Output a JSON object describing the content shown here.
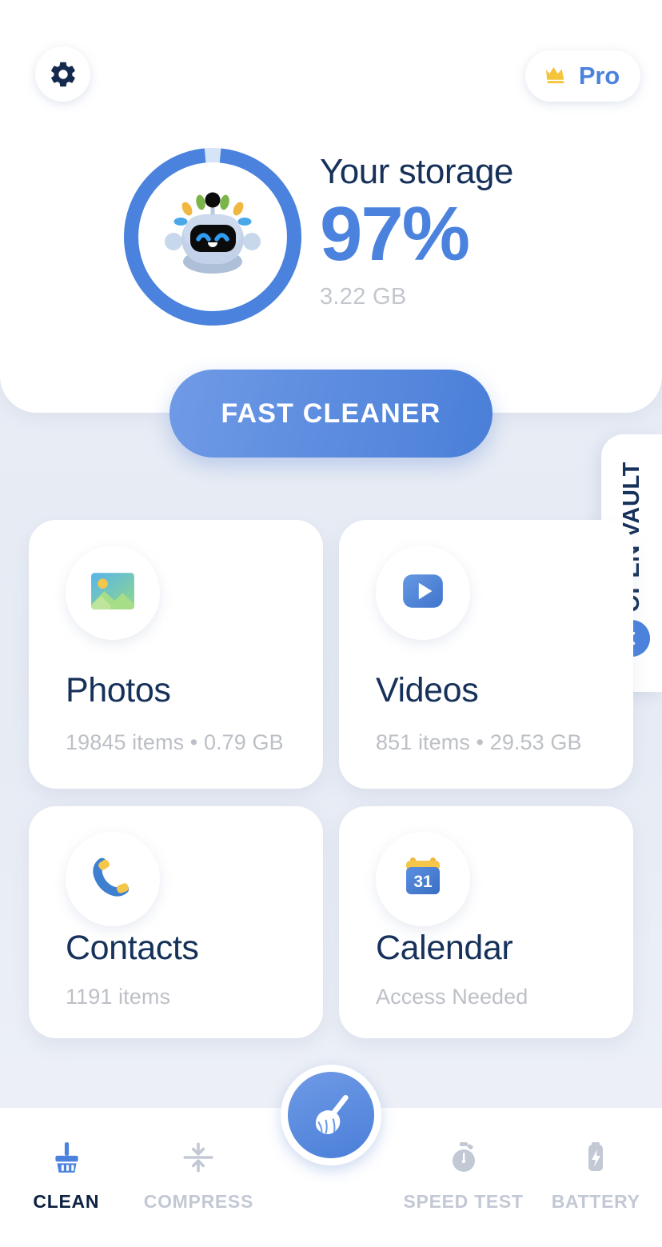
{
  "header": {
    "settings_icon": "gear-icon",
    "pro": {
      "label": "Pro",
      "icon": "crown-icon",
      "color": "#4a82dd",
      "crown_color": "#f5c43d"
    }
  },
  "storage": {
    "title": "Your storage",
    "percent_label": "97%",
    "percent_value": 97,
    "size_label": "3.22  GB",
    "ring_color": "#4a82dd",
    "ring_track_color": "#d6e4f7",
    "percent_color": "#4a82dd",
    "mascot_icon": "robot-mascot-icon"
  },
  "primary_action": {
    "label": "FAST CLEANER"
  },
  "vault": {
    "label": "OPEN VAULT",
    "chevron_icon": "chevron-left-icon"
  },
  "categories": [
    {
      "id": "photos",
      "icon": "photo-icon",
      "title": "Photos",
      "subtitle": "19845 items • 0.79 GB"
    },
    {
      "id": "videos",
      "icon": "video-play-icon",
      "title": "Videos",
      "subtitle": "851 items • 29.53 GB"
    },
    {
      "id": "contacts",
      "icon": "phone-icon",
      "title": "Contacts",
      "subtitle": "1191 items"
    },
    {
      "id": "calendar",
      "icon": "calendar-icon",
      "title": "Calendar",
      "subtitle": "Access Needed",
      "calendar_day": "31"
    }
  ],
  "bottom_nav": {
    "items": [
      {
        "id": "clean",
        "label": "CLEAN",
        "icon": "broom-icon",
        "active": true
      },
      {
        "id": "compress",
        "label": "COMPRESS",
        "icon": "compress-arrows-icon",
        "active": false
      },
      {
        "id": "speed_test",
        "label": "SPEED TEST",
        "icon": "stopwatch-icon",
        "active": false
      },
      {
        "id": "battery",
        "label": "BATTERY",
        "icon": "battery-bolt-icon",
        "active": false
      }
    ],
    "fab": {
      "id": "fab-clean",
      "icon": "broom-icon"
    }
  }
}
